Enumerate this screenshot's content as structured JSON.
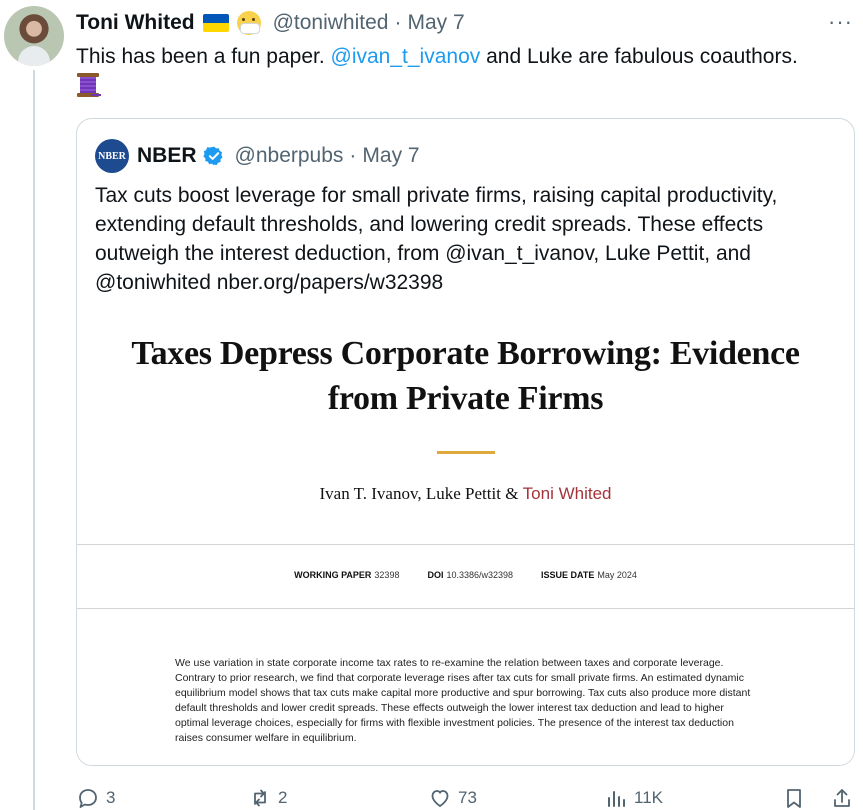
{
  "tweet": {
    "author_name": "Toni Whited",
    "handle": "@toniwhited",
    "date": "May 7",
    "text_before": "This has been a fun paper. ",
    "mention": "@ivan_t_ivanov",
    "text_after": "  and Luke are fabulous coauthors.",
    "emoji_after_text": "spool-of-thread-icon",
    "more_label": "···"
  },
  "quote": {
    "author_name": "NBER",
    "logo_text": "NBER",
    "handle": "@nberpubs",
    "date": "May 7",
    "text": "Tax cuts boost leverage for small private firms, raising capital productivity, extending default thresholds, and lowering credit spreads. These effects outweigh the interest deduction, from @ivan_t_ivanov, Luke Pettit, and @toniwhited nber.org/papers/w32398"
  },
  "paper": {
    "title_line1": "Taxes Depress Corporate Borrowing: Evidence",
    "title_line2": "from Private Firms",
    "authors_plain": "Ivan T. Ivanov, Luke Pettit & ",
    "author_highlight": "Toni Whited",
    "wp_label": "WORKING PAPER",
    "wp_value": "32398",
    "doi_label": "DOI",
    "doi_value": "10.3386/w32398",
    "issue_label": "ISSUE DATE",
    "issue_value": "May 2024",
    "abstract": "We use variation in state corporate income tax rates to re-examine the relation between taxes and corporate leverage. Contrary to prior research, we find that corporate leverage rises after tax cuts for small private firms. An estimated dynamic equilibrium model shows that tax cuts make capital more productive and spur borrowing. Tax cuts also produce more distant default thresholds and lower credit spreads. These effects outweigh the lower interest tax deduction and lead to higher optimal leverage choices, especially for firms with flexible investment policies. The presence of the interest tax deduction raises consumer welfare in equilibrium."
  },
  "actions": {
    "replies": "3",
    "retweets": "2",
    "likes": "73",
    "views": "11K"
  },
  "colors": {
    "link": "#1d9bf0",
    "nber_blue": "#1e4b8f",
    "gold": "#e0a93b",
    "author_red": "#a3343a"
  }
}
